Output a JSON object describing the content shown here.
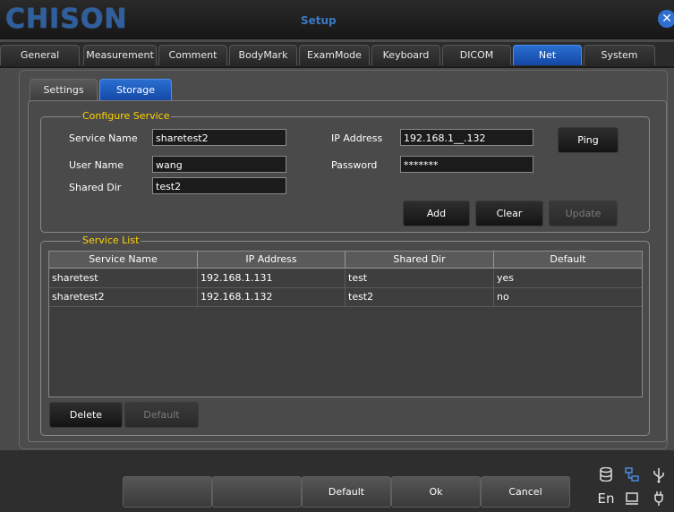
{
  "window": {
    "logo": "CHISON",
    "title": "Setup"
  },
  "tabs": [
    {
      "label": "General"
    },
    {
      "label": "Measurement"
    },
    {
      "label": "Comment"
    },
    {
      "label": "BodyMark"
    },
    {
      "label": "ExamMode"
    },
    {
      "label": "Keyboard"
    },
    {
      "label": "DICOM"
    },
    {
      "label": "Net"
    },
    {
      "label": "System"
    }
  ],
  "active_tab": "Net",
  "subtabs": [
    {
      "label": "Settings"
    },
    {
      "label": "Storage"
    }
  ],
  "configure": {
    "title": "Configure Service",
    "service_name_label": "Service Name",
    "service_name_value": "sharetest2",
    "user_name_label": "User Name",
    "user_name_value": "wang",
    "shared_dir_label": "Shared Dir",
    "shared_dir_value": "test2",
    "ip_label": "IP Address",
    "ip_value": "192.168.1__.132",
    "password_label": "Password",
    "password_value": "*******",
    "ping": "Ping",
    "add": "Add",
    "clear": "Clear",
    "update": "Update"
  },
  "service_list": {
    "title": "Service List",
    "columns": [
      "Service Name",
      "IP Address",
      "Shared Dir",
      "Default"
    ],
    "rows": [
      [
        "sharetest",
        "192.168.1.131",
        "test",
        "yes"
      ],
      [
        "sharetest2",
        "192.168.1.132",
        "test2",
        "no"
      ]
    ],
    "delete": "Delete",
    "default": "Default"
  },
  "bottom": {
    "default": "Default",
    "ok": "Ok",
    "cancel": "Cancel",
    "lang": "En"
  },
  "icons": [
    "database-icon",
    "network-icon",
    "usb-icon",
    "display-icon",
    "printer-icon"
  ],
  "colors": {
    "accent": "#1f5fc4",
    "group_title": "#ffd200"
  }
}
